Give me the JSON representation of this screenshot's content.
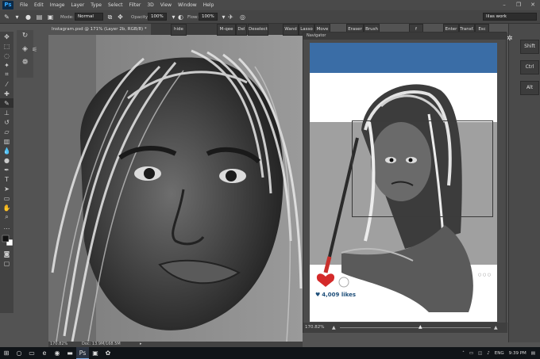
{
  "app": {
    "logo": "Ps",
    "menu": [
      "File",
      "Edit",
      "Image",
      "Layer",
      "Type",
      "Select",
      "Filter",
      "3D",
      "View",
      "Window",
      "Help"
    ],
    "window_controls": [
      "–",
      "❐",
      "✕"
    ]
  },
  "options_bar": {
    "mode_label": "Mode:",
    "mode_value": "Normal",
    "opacity_label": "Opacity:",
    "opacity_value": "100%",
    "flow_label": "Flow:",
    "flow_value": "100%",
    "workspace_value": "lilas work"
  },
  "document": {
    "tab_title": "Instagram.psd @ 171% (Layer 2b, RGB/8) *",
    "tab_close": "×",
    "zoom": "170.82%",
    "doc_info": "Doc: 13.9M/168.5M"
  },
  "shortcuts": {
    "hide": "hide",
    "mqee": "M-qee",
    "del": "Del",
    "deselect": "Deselect",
    "wand": "Wand",
    "lasso": "Lasso",
    "move": "Move",
    "eraser": "Eraser",
    "brush": "Brush",
    "f": "f",
    "enter": "Enter",
    "transf": "Transf.",
    "esc": "Esc"
  },
  "navigator": {
    "title": "Navigator",
    "zoom": "170.82%",
    "likes": "4,009 likes",
    "dots": "○ ○ ○"
  },
  "dock": {
    "shift": "Shift",
    "ctrl": "Ctrl",
    "alt": "Alt"
  },
  "taskbar": {
    "language": "ENG",
    "time": "9:39 PM"
  },
  "colors": {
    "accent_blue": "#3a6da6",
    "likes_blue": "#1f4f7a",
    "heart_red": "#d42a2a",
    "ui_dark": "#535353"
  }
}
